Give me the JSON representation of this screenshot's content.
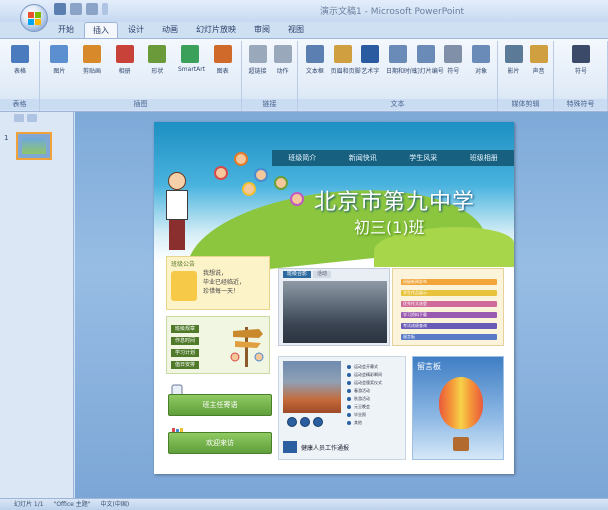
{
  "app": {
    "window_title": "演示文稿1 - Microsoft PowerPoint"
  },
  "tabs": [
    {
      "label": "开始",
      "active": false
    },
    {
      "label": "插入",
      "active": true
    },
    {
      "label": "设计",
      "active": false
    },
    {
      "label": "动画",
      "active": false
    },
    {
      "label": "幻灯片放映",
      "active": false
    },
    {
      "label": "审阅",
      "active": false
    },
    {
      "label": "视图",
      "active": false
    }
  ],
  "ribbon": {
    "groups": [
      {
        "label": "表格",
        "buttons": [
          {
            "label": "表格",
            "icon": "table-icon",
            "color": "#4a7bbf"
          }
        ]
      },
      {
        "label": "插图",
        "buttons": [
          {
            "label": "图片",
            "icon": "picture-icon",
            "color": "#5b8fd0"
          },
          {
            "label": "剪贴画",
            "icon": "clipart-icon",
            "color": "#d88a2a"
          },
          {
            "label": "相册",
            "icon": "album-icon",
            "color": "#c9423a"
          },
          {
            "label": "形状",
            "icon": "shapes-icon",
            "color": "#6a9a3a"
          },
          {
            "label": "SmartArt",
            "icon": "smartart-icon",
            "color": "#3aa05a"
          },
          {
            "label": "图表",
            "icon": "chart-icon",
            "color": "#d06a2a"
          }
        ]
      },
      {
        "label": "链接",
        "buttons": [
          {
            "label": "超链接",
            "icon": "hyperlink-icon",
            "color": "#9aa8bb"
          },
          {
            "label": "动作",
            "icon": "action-icon",
            "color": "#9aa8bb"
          }
        ]
      },
      {
        "label": "文本",
        "buttons": [
          {
            "label": "文本框",
            "icon": "textbox-icon",
            "color": "#5b7fb0"
          },
          {
            "label": "页眉和页脚",
            "icon": "header-footer-icon",
            "color": "#d0a040"
          },
          {
            "label": "艺术字",
            "icon": "wordart-icon",
            "color": "#2a5aa0"
          },
          {
            "label": "日期和时间",
            "icon": "datetime-icon",
            "color": "#6a8ab8"
          },
          {
            "label": "幻灯片编号",
            "icon": "slide-number-icon",
            "color": "#6a8ab8"
          },
          {
            "label": "符号",
            "icon": "symbol-icon",
            "color": "#8090a8"
          },
          {
            "label": "对象",
            "icon": "object-icon",
            "color": "#6a8ab8"
          }
        ]
      },
      {
        "label": "媒体剪辑",
        "buttons": [
          {
            "label": "影片",
            "icon": "movie-icon",
            "color": "#5a7a98"
          },
          {
            "label": "声音",
            "icon": "sound-icon",
            "color": "#d0a040"
          }
        ]
      },
      {
        "label": "特殊符号",
        "buttons": [
          {
            "label": "符号",
            "icon": "special-symbol-icon",
            "color": "#3a4a68"
          }
        ]
      }
    ]
  },
  "slides_panel": {
    "thumbnail_number": "1"
  },
  "slide": {
    "nav_links": [
      "班级简介",
      "新闻快讯",
      "学生风采",
      "班级相册"
    ],
    "school_name": "北京市第九中学",
    "class_name": "初三(1)班",
    "notice_title": "班级公告",
    "notice_lines": [
      "我想说，",
      "毕业已经临近，",
      "珍惜每一天！"
    ],
    "rules": [
      "班级规章",
      "作息时间",
      "学习计划",
      "值日安排"
    ],
    "photo_tabs": [
      "班级合影",
      "活动"
    ],
    "links": [
      {
        "text": "班级新闻发布",
        "color": "#f2a63a"
      },
      {
        "text": "学生作品展示",
        "color": "#e8c23a"
      },
      {
        "text": "优秀作文选登",
        "color": "#d06a9a"
      },
      {
        "text": "学习资料下载",
        "color": "#9a5ab0"
      },
      {
        "text": "考试成绩查询",
        "color": "#6a5ab8"
      },
      {
        "text": "留言板",
        "color": "#5a7ac8"
      }
    ],
    "button_1": "班主任寄语",
    "button_2": "欢迎来访",
    "sports_list": [
      "运动会开幕式",
      "运动会精彩瞬间",
      "运动会颁奖仪式",
      "春游活动",
      "秋游活动",
      "元旦晚会",
      "毕业照",
      "其他"
    ],
    "bottom_caption": "健康人员工作通报",
    "balloon_title": "留言板"
  },
  "statusbar": {
    "slide_info": "幻灯片 1/1",
    "theme": "\"Office 主题\"",
    "language": "中文(中国)"
  }
}
